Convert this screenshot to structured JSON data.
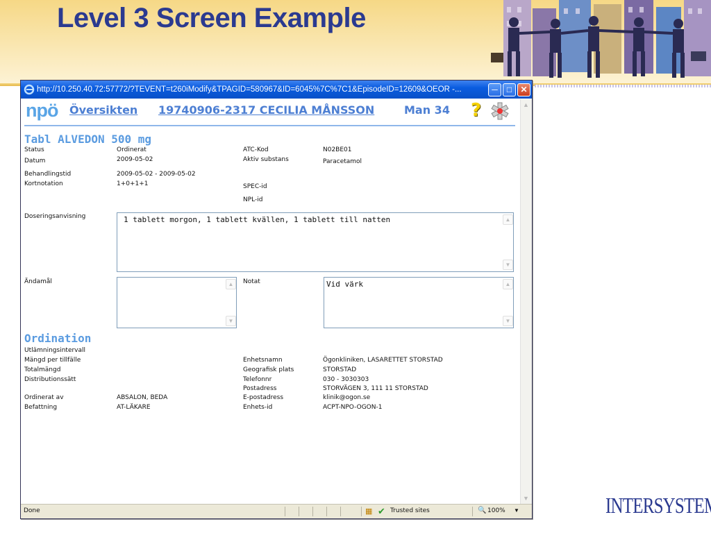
{
  "slide": {
    "title": "Level 3 Screen Example",
    "logo": "INTERSYSTEMS"
  },
  "browser": {
    "url": "http://10.250.40.72:57772/?TEVENT=t260iModify&TPAGID=580967&ID=6045%7C%7C1&EpisodeID=12609&OEOR -...",
    "status_text": "Done",
    "zone": "Trusted sites",
    "zoom": "100%"
  },
  "header": {
    "logo": "npö",
    "overview_link": "Översikten",
    "patient_link": "19740906-2317 CECILIA MÅNSSON",
    "patient_info": "Man 34"
  },
  "drug": {
    "title": "Tabl ALVEDON 500 mg",
    "status_label": "Status",
    "status_value": "Ordinerat",
    "date_label": "Datum",
    "date_value": "2009-05-02",
    "period_label": "Behandlingstid",
    "period_value": "2009-05-02 - 2009-05-02",
    "short_label": "Kortnotation",
    "short_value": "1+0+1+1",
    "atc_label": "ATC-Kod",
    "atc_value": "N02BE01",
    "substance_label": "Aktiv substans",
    "substance_value": "Paracetamol",
    "spec_label": "SPEC-id",
    "npl_label": "NPL-id",
    "dosage_label": "Doseringsanvisning",
    "dosage_value": "1 tablett morgon, 1 tablett kvällen, 1 tablett till natten",
    "purpose_label": "Ändamål",
    "purpose_value": "",
    "note_label": "Notat",
    "note_value": "Vid värk"
  },
  "ordination": {
    "title": "Ordination",
    "interval_label": "Utlämningsintervall",
    "amount_label": "Mängd per tillfälle",
    "total_label": "Totalmängd",
    "distribution_label": "Distributionssätt",
    "ordered_label": "Ordinerat av",
    "ordered_value": "ABSALON, BEDA",
    "position_label": "Befattning",
    "position_value": "AT-LÄKARE",
    "unit_name_label": "Enhetsnamn",
    "unit_name_value": "Ögonkliniken, LASARETTET STORSTAD",
    "geo_label": "Geografisk plats",
    "geo_value": "STORSTAD",
    "phone_label": "Telefonnr",
    "phone_value": "030 - 3030303",
    "address_label": "Postadress",
    "address_value": "STORVÄGEN 3, 111 11 STORSTAD",
    "email_label": "E-postadress",
    "email_value": "klinik@ogon.se",
    "unit_id_label": "Enhets-id",
    "unit_id_value": "ACPT-NPO-OGON-1"
  }
}
